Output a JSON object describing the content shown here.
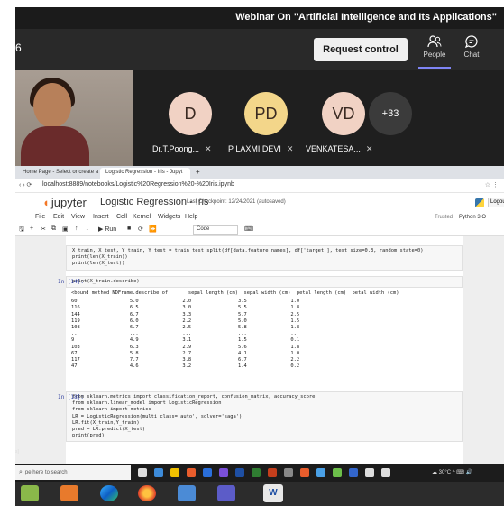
{
  "teams": {
    "title": "Webinar On \"Artificial Intelligence and Its Applications\"",
    "meeting_time_fragment": "6",
    "request_control_label": "Request control",
    "people_label": "People",
    "chat_label": "Chat",
    "participants": [
      {
        "initials": "D",
        "name": "Dr.T.Poong..."
      },
      {
        "initials": "PD",
        "name": "P LAXMI DEVI"
      },
      {
        "initials": "VD",
        "name": "VENKATESA..."
      }
    ],
    "more_count": "+33"
  },
  "browser": {
    "tabs": [
      "Home Page - Select or create a",
      "Logistic Regression - Iris - Jupyt",
      "+"
    ],
    "url": "localhost:8889/notebooks/Logistic%20Regression%20-%20Iris.ipynb"
  },
  "jupyter": {
    "logo_text": "jupyter",
    "notebook_title": "Logistic Regression - Iris",
    "checkpoint": "Last Checkpoint: 12/24/2021 (autosaved)",
    "menu": [
      "File",
      "Edit",
      "View",
      "Insert",
      "Cell",
      "Kernel",
      "Widgets",
      "Help"
    ],
    "trusted": "Trusted",
    "kernel": "Python 3 O",
    "logout": "Logout",
    "toolbar": {
      "run_label": "Run",
      "celltype": "Code"
    },
    "cells": [
      {
        "prompt": "",
        "code_lines": [
          "X_train, X_test, Y_train, Y_test = train_test_split(df[data.feature_names], df['target'], test_size=0.3, random_state=0)",
          "print(len(X_train))",
          "print(len(X_test))"
        ]
      },
      {
        "prompt": "In [14]:",
        "code_lines": [
          "print(X_train.describe)"
        ]
      },
      {
        "output_lines": [
          "<bound method NDFrame.describe of       sepal length (cm)  sepal width (cm)  petal length (cm)  petal width (cm)",
          "60                  5.0               2.0                3.5               1.0",
          "116                 6.5               3.0                5.5               1.8",
          "144                 6.7               3.3                5.7               2.5",
          "119                 6.0               2.2                5.0               1.5",
          "108                 6.7               2.5                5.8               1.8",
          "..                  ...               ...                ...               ...",
          "9                   4.9               3.1                1.5               0.1",
          "103                 6.3               2.9                5.6               1.8",
          "67                  5.8               2.7                4.1               1.0",
          "117                 7.7               3.8                6.7               2.2",
          "47                  4.6               3.2                1.4               0.2",
          "",
          "[105 rows x 4 columns]>"
        ]
      },
      {
        "prompt": "In [18]:",
        "code_lines": [
          "from sklearn.metrics import classification_report, confusion_matrix, accuracy_score",
          "from sklearn.linear_model import LogisticRegression",
          "from sklearn import metrics",
          "",
          "LR = LogisticRegression(multi_class='auto', solver='saga')",
          "LR.fit(X_train,Y_train)",
          "",
          "pred = LR.predict(X_test)",
          "",
          "print(pred)"
        ]
      }
    ]
  },
  "windows": {
    "search_placeholder": "pe here to search",
    "temperature": "30°C",
    "side_fragment": "s]"
  },
  "dock": {
    "word_letter": "W"
  }
}
